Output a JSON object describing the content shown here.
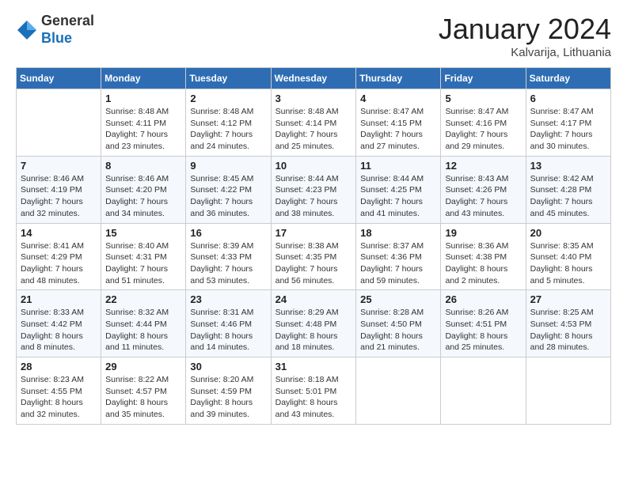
{
  "header": {
    "logo": {
      "line1": "General",
      "line2": "Blue"
    },
    "title": "January 2024",
    "location": "Kalvarija, Lithuania"
  },
  "weekdays": [
    "Sunday",
    "Monday",
    "Tuesday",
    "Wednesday",
    "Thursday",
    "Friday",
    "Saturday"
  ],
  "weeks": [
    [
      {
        "date": "",
        "info": ""
      },
      {
        "date": "1",
        "info": "Sunrise: 8:48 AM\nSunset: 4:11 PM\nDaylight: 7 hours\nand 23 minutes."
      },
      {
        "date": "2",
        "info": "Sunrise: 8:48 AM\nSunset: 4:12 PM\nDaylight: 7 hours\nand 24 minutes."
      },
      {
        "date": "3",
        "info": "Sunrise: 8:48 AM\nSunset: 4:14 PM\nDaylight: 7 hours\nand 25 minutes."
      },
      {
        "date": "4",
        "info": "Sunrise: 8:47 AM\nSunset: 4:15 PM\nDaylight: 7 hours\nand 27 minutes."
      },
      {
        "date": "5",
        "info": "Sunrise: 8:47 AM\nSunset: 4:16 PM\nDaylight: 7 hours\nand 29 minutes."
      },
      {
        "date": "6",
        "info": "Sunrise: 8:47 AM\nSunset: 4:17 PM\nDaylight: 7 hours\nand 30 minutes."
      }
    ],
    [
      {
        "date": "7",
        "info": "Sunrise: 8:46 AM\nSunset: 4:19 PM\nDaylight: 7 hours\nand 32 minutes."
      },
      {
        "date": "8",
        "info": "Sunrise: 8:46 AM\nSunset: 4:20 PM\nDaylight: 7 hours\nand 34 minutes."
      },
      {
        "date": "9",
        "info": "Sunrise: 8:45 AM\nSunset: 4:22 PM\nDaylight: 7 hours\nand 36 minutes."
      },
      {
        "date": "10",
        "info": "Sunrise: 8:44 AM\nSunset: 4:23 PM\nDaylight: 7 hours\nand 38 minutes."
      },
      {
        "date": "11",
        "info": "Sunrise: 8:44 AM\nSunset: 4:25 PM\nDaylight: 7 hours\nand 41 minutes."
      },
      {
        "date": "12",
        "info": "Sunrise: 8:43 AM\nSunset: 4:26 PM\nDaylight: 7 hours\nand 43 minutes."
      },
      {
        "date": "13",
        "info": "Sunrise: 8:42 AM\nSunset: 4:28 PM\nDaylight: 7 hours\nand 45 minutes."
      }
    ],
    [
      {
        "date": "14",
        "info": "Sunrise: 8:41 AM\nSunset: 4:29 PM\nDaylight: 7 hours\nand 48 minutes."
      },
      {
        "date": "15",
        "info": "Sunrise: 8:40 AM\nSunset: 4:31 PM\nDaylight: 7 hours\nand 51 minutes."
      },
      {
        "date": "16",
        "info": "Sunrise: 8:39 AM\nSunset: 4:33 PM\nDaylight: 7 hours\nand 53 minutes."
      },
      {
        "date": "17",
        "info": "Sunrise: 8:38 AM\nSunset: 4:35 PM\nDaylight: 7 hours\nand 56 minutes."
      },
      {
        "date": "18",
        "info": "Sunrise: 8:37 AM\nSunset: 4:36 PM\nDaylight: 7 hours\nand 59 minutes."
      },
      {
        "date": "19",
        "info": "Sunrise: 8:36 AM\nSunset: 4:38 PM\nDaylight: 8 hours\nand 2 minutes."
      },
      {
        "date": "20",
        "info": "Sunrise: 8:35 AM\nSunset: 4:40 PM\nDaylight: 8 hours\nand 5 minutes."
      }
    ],
    [
      {
        "date": "21",
        "info": "Sunrise: 8:33 AM\nSunset: 4:42 PM\nDaylight: 8 hours\nand 8 minutes."
      },
      {
        "date": "22",
        "info": "Sunrise: 8:32 AM\nSunset: 4:44 PM\nDaylight: 8 hours\nand 11 minutes."
      },
      {
        "date": "23",
        "info": "Sunrise: 8:31 AM\nSunset: 4:46 PM\nDaylight: 8 hours\nand 14 minutes."
      },
      {
        "date": "24",
        "info": "Sunrise: 8:29 AM\nSunset: 4:48 PM\nDaylight: 8 hours\nand 18 minutes."
      },
      {
        "date": "25",
        "info": "Sunrise: 8:28 AM\nSunset: 4:50 PM\nDaylight: 8 hours\nand 21 minutes."
      },
      {
        "date": "26",
        "info": "Sunrise: 8:26 AM\nSunset: 4:51 PM\nDaylight: 8 hours\nand 25 minutes."
      },
      {
        "date": "27",
        "info": "Sunrise: 8:25 AM\nSunset: 4:53 PM\nDaylight: 8 hours\nand 28 minutes."
      }
    ],
    [
      {
        "date": "28",
        "info": "Sunrise: 8:23 AM\nSunset: 4:55 PM\nDaylight: 8 hours\nand 32 minutes."
      },
      {
        "date": "29",
        "info": "Sunrise: 8:22 AM\nSunset: 4:57 PM\nDaylight: 8 hours\nand 35 minutes."
      },
      {
        "date": "30",
        "info": "Sunrise: 8:20 AM\nSunset: 4:59 PM\nDaylight: 8 hours\nand 39 minutes."
      },
      {
        "date": "31",
        "info": "Sunrise: 8:18 AM\nSunset: 5:01 PM\nDaylight: 8 hours\nand 43 minutes."
      },
      {
        "date": "",
        "info": ""
      },
      {
        "date": "",
        "info": ""
      },
      {
        "date": "",
        "info": ""
      }
    ]
  ]
}
